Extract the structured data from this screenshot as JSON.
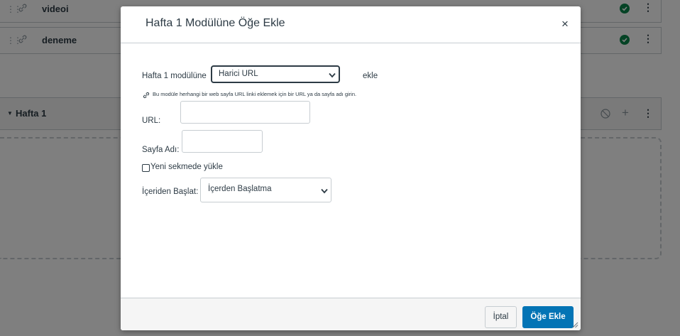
{
  "background": {
    "items": [
      {
        "title": "videoi"
      },
      {
        "title": "deneme"
      }
    ],
    "module_title": "Hafta 1"
  },
  "dialog": {
    "title": "Hafta 1 Modülüne Öğe Ekle",
    "close_glyph": "×",
    "module_prefix": "Hafta 1 modülüne",
    "item_type_selected": "Harici URL",
    "module_suffix": "ekle",
    "hint": "Bu modüle herhangi bir web sayfa URL linki eklemek için bir URL ya da sayfa adı girin.",
    "url_label": "URL:",
    "url_value": "",
    "page_name_label": "Sayfa Adı:",
    "page_name_value": "",
    "new_tab_label": "Yeni sekmede yükle",
    "new_tab_checked": false,
    "indent_label": "İçeriden Başlat:",
    "indent_selected": "İçerden Başlatma",
    "cancel_label": "İptal",
    "add_label": "Öğe Ekle"
  },
  "colors": {
    "primary": "#0374b5",
    "published": "#0b874b",
    "text": "#2d3b45",
    "overlay": "rgba(0,0,0,0.5)"
  },
  "icons": {
    "drag": "drag-handle-icon",
    "link": "link-icon",
    "published": "check-circle-icon",
    "menu": "kebab-menu-icon",
    "unpublished": "ban-icon",
    "add": "plus-icon",
    "close": "close-icon",
    "dropdown": "chevron-down-icon"
  }
}
